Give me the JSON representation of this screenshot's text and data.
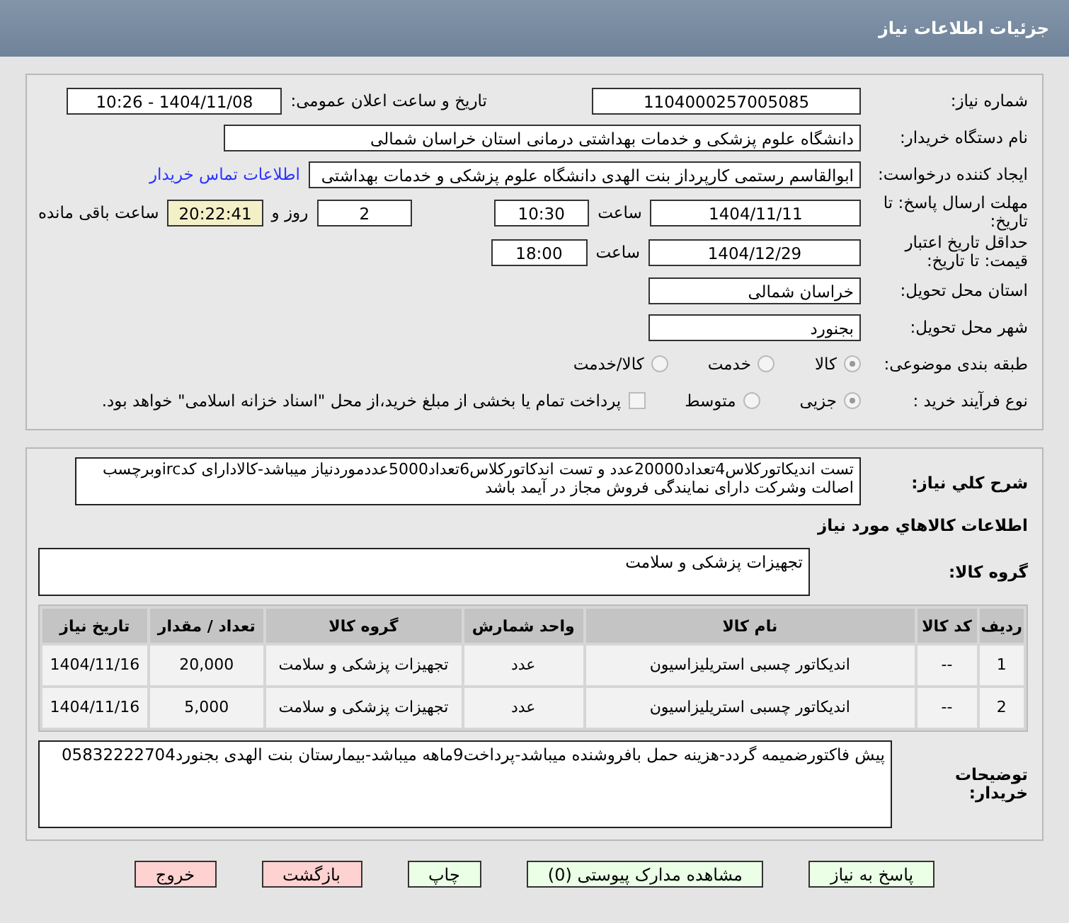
{
  "header": {
    "title": "جزئیات اطلاعات نیاز"
  },
  "info": {
    "need_number": {
      "label": "شماره نیاز:",
      "value": "1104000257005085"
    },
    "announce": {
      "label": "تاریخ و ساعت اعلان عمومی:",
      "value": "1404/11/08 - 10:26"
    },
    "buyer_org": {
      "label": "نام دستگاه خریدار:",
      "value": "دانشگاه علوم پزشکی و خدمات بهداشتی درمانی استان خراسان شمالی"
    },
    "requester": {
      "label": "ایجاد کننده درخواست:",
      "value": "ابوالقاسم رستمی کارپرداز بنت الهدی دانشگاه علوم پزشکی و خدمات بهداشتی",
      "link": "اطلاعات تماس خریدار"
    },
    "deadline": {
      "label": "مهلت ارسال پاسخ: تا تاریخ:",
      "date": "1404/11/11",
      "time_label": "ساعت",
      "time": "10:30",
      "days": "2",
      "days_label": "روز و",
      "remaining": "20:22:41",
      "remaining_label": "ساعت باقی مانده"
    },
    "validity": {
      "label": "حداقل تاریخ اعتبار قیمت: تا تاریخ:",
      "date": "1404/12/29",
      "time_label": "ساعت",
      "time": "18:00"
    },
    "province": {
      "label": "استان محل تحویل:",
      "value": "خراسان شمالی"
    },
    "city": {
      "label": "شهر محل تحویل:",
      "value": "بجنورد"
    },
    "category": {
      "label": "طبقه بندی موضوعی:",
      "options": [
        {
          "label": "کالا",
          "selected": true
        },
        {
          "label": "خدمت",
          "selected": false
        },
        {
          "label": "کالا/خدمت",
          "selected": false
        }
      ]
    },
    "process": {
      "label": "نوع فرآیند خرید :",
      "options": [
        {
          "label": "جزیی",
          "selected": true
        },
        {
          "label": "متوسط",
          "selected": false
        }
      ],
      "treasury": {
        "label": "پرداخت تمام یا بخشی از مبلغ خرید،از محل \"اسناد خزانه اسلامی\" خواهد بود.",
        "checked": false
      }
    }
  },
  "details": {
    "description": {
      "label": "شرح کلي نياز:",
      "value": "تست اندیکاتورکلاس4تعداد20000عدد و تست اندکاتورکلاس6تعداد5000عددموردنیاز میباشد-کالادارای کدircوبرچسب اصالت وشرکت دارای نمایندگی فروش مجاز در آیمد باشد"
    },
    "goods_heading": "اطلاعات کالاهاي مورد نياز",
    "goods_group": {
      "label": "گروه کالا:",
      "value": "تجهیزات پزشکی و سلامت"
    },
    "table": {
      "columns": [
        "ردیف",
        "کد کالا",
        "نام کالا",
        "واحد شمارش",
        "گروه کالا",
        "تعداد / مقدار",
        "تاریخ نیاز"
      ],
      "rows": [
        [
          "1",
          "--",
          "اندیکاتور چسبی استریلیزاسیون",
          "عدد",
          "تجهیزات پزشکی و سلامت",
          "20,000",
          "1404/11/16"
        ],
        [
          "2",
          "--",
          "اندیکاتور چسبی استریلیزاسیون",
          "عدد",
          "تجهیزات پزشکی و سلامت",
          "5,000",
          "1404/11/16"
        ]
      ]
    },
    "buyer_notes": {
      "label": "توضیحات خریدار:",
      "value": "پیش فاکتورضمیمه گردد-هزینه حمل بافروشنده میباشد-پرداخت9ماهه میباشد-بیمارستان بنت الهدی بجنورد05832222704"
    }
  },
  "buttons": [
    {
      "label": "پاسخ به نیاز",
      "kind": "primary"
    },
    {
      "label": "مشاهده مدارک پیوستی (0)",
      "kind": "primary"
    },
    {
      "label": "چاپ",
      "kind": "primary"
    },
    {
      "label": "بازگشت",
      "kind": "danger"
    },
    {
      "label": "خروج",
      "kind": "danger"
    }
  ]
}
